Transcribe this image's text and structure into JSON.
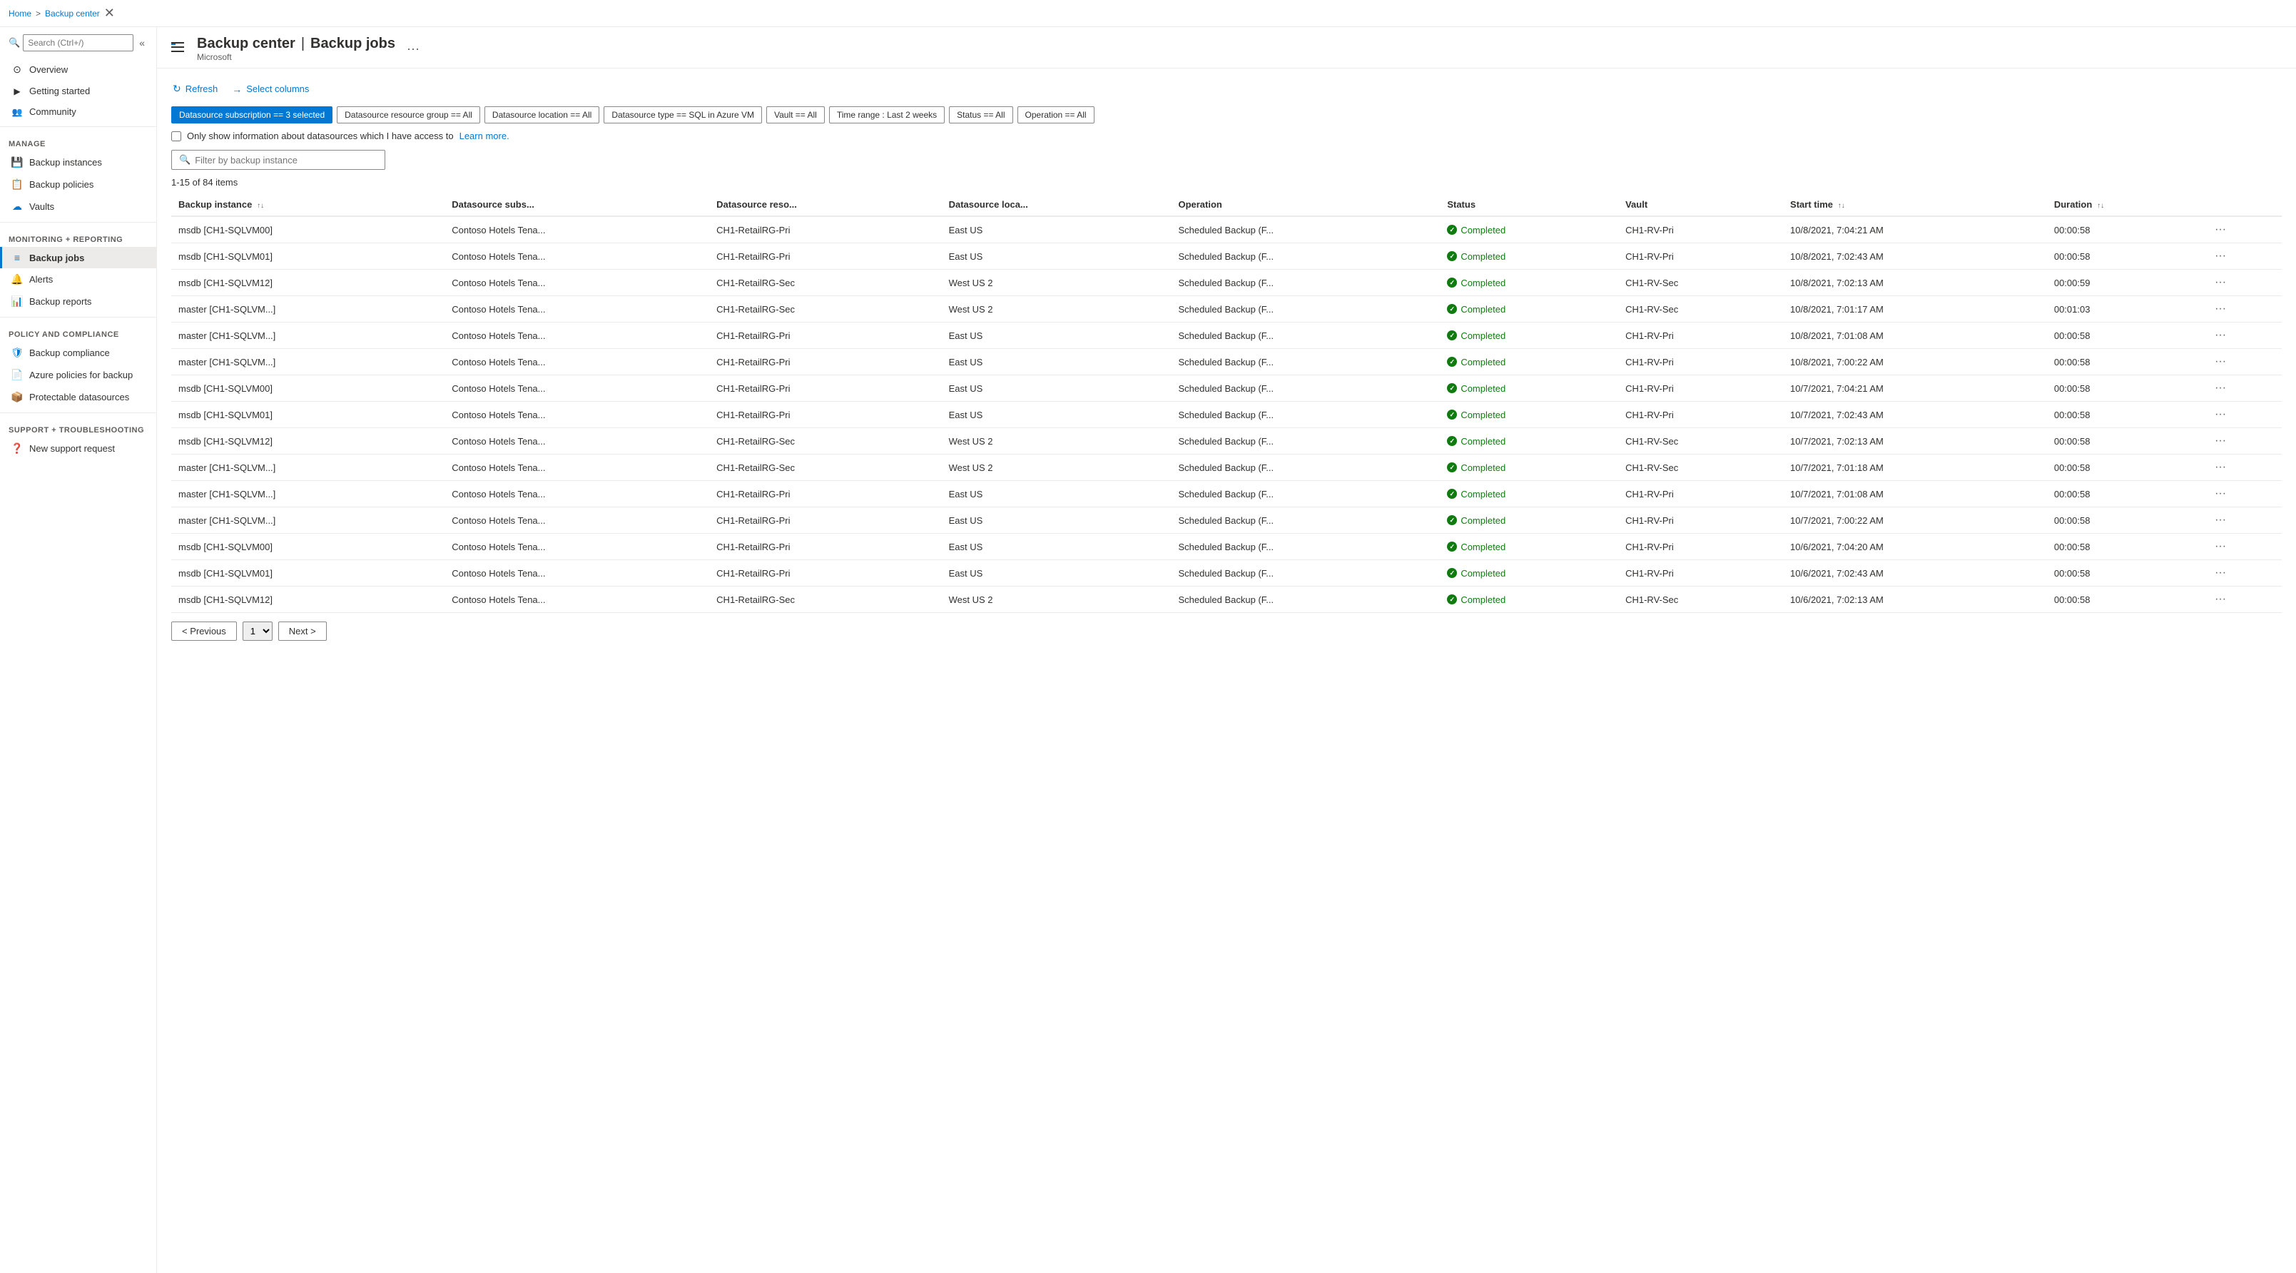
{
  "breadcrumb": {
    "home": "Home",
    "section": "Backup center"
  },
  "header": {
    "title": "Backup center",
    "separator": "|",
    "page": "Backup jobs",
    "subtitle": "Microsoft",
    "more_label": "···"
  },
  "toolbar": {
    "refresh_label": "Refresh",
    "select_columns_label": "Select columns"
  },
  "filters": [
    {
      "id": "datasource_subscription",
      "label": "Datasource subscription == 3 selected",
      "active": true
    },
    {
      "id": "datasource_resource_group",
      "label": "Datasource resource group == All",
      "active": false
    },
    {
      "id": "datasource_location",
      "label": "Datasource location == All",
      "active": false
    },
    {
      "id": "datasource_type",
      "label": "Datasource type == SQL in Azure VM",
      "active": false
    },
    {
      "id": "vault",
      "label": "Vault == All",
      "active": false
    },
    {
      "id": "time_range",
      "label": "Time range : Last 2 weeks",
      "active": false
    },
    {
      "id": "status",
      "label": "Status == All",
      "active": false
    },
    {
      "id": "operation",
      "label": "Operation == All",
      "active": false
    }
  ],
  "checkbox": {
    "label": "Only show information about datasources which I have access to",
    "learn_more": "Learn more."
  },
  "filter_search": {
    "placeholder": "Filter by backup instance"
  },
  "items_count": "1-15 of 84 items",
  "table": {
    "columns": [
      {
        "id": "backup_instance",
        "label": "Backup instance",
        "sortable": true
      },
      {
        "id": "datasource_subs",
        "label": "Datasource subs...",
        "sortable": false
      },
      {
        "id": "datasource_reso",
        "label": "Datasource reso...",
        "sortable": false
      },
      {
        "id": "datasource_loca",
        "label": "Datasource loca...",
        "sortable": false
      },
      {
        "id": "operation",
        "label": "Operation",
        "sortable": false
      },
      {
        "id": "status",
        "label": "Status",
        "sortable": false
      },
      {
        "id": "vault",
        "label": "Vault",
        "sortable": false
      },
      {
        "id": "start_time",
        "label": "Start time",
        "sortable": true
      },
      {
        "id": "duration",
        "label": "Duration",
        "sortable": true
      }
    ],
    "rows": [
      {
        "backup_instance": "msdb [CH1-SQLVM00]",
        "datasource_subs": "Contoso Hotels Tena...",
        "datasource_reso": "CH1-RetailRG-Pri",
        "datasource_loca": "East US",
        "operation": "Scheduled Backup (F...",
        "status": "Completed",
        "vault": "CH1-RV-Pri",
        "start_time": "10/8/2021, 7:04:21 AM",
        "duration": "00:00:58"
      },
      {
        "backup_instance": "msdb [CH1-SQLVM01]",
        "datasource_subs": "Contoso Hotels Tena...",
        "datasource_reso": "CH1-RetailRG-Pri",
        "datasource_loca": "East US",
        "operation": "Scheduled Backup (F...",
        "status": "Completed",
        "vault": "CH1-RV-Pri",
        "start_time": "10/8/2021, 7:02:43 AM",
        "duration": "00:00:58"
      },
      {
        "backup_instance": "msdb [CH1-SQLVM12]",
        "datasource_subs": "Contoso Hotels Tena...",
        "datasource_reso": "CH1-RetailRG-Sec",
        "datasource_loca": "West US 2",
        "operation": "Scheduled Backup (F...",
        "status": "Completed",
        "vault": "CH1-RV-Sec",
        "start_time": "10/8/2021, 7:02:13 AM",
        "duration": "00:00:59"
      },
      {
        "backup_instance": "master [CH1-SQLVM...]",
        "datasource_subs": "Contoso Hotels Tena...",
        "datasource_reso": "CH1-RetailRG-Sec",
        "datasource_loca": "West US 2",
        "operation": "Scheduled Backup (F...",
        "status": "Completed",
        "vault": "CH1-RV-Sec",
        "start_time": "10/8/2021, 7:01:17 AM",
        "duration": "00:01:03"
      },
      {
        "backup_instance": "master [CH1-SQLVM...]",
        "datasource_subs": "Contoso Hotels Tena...",
        "datasource_reso": "CH1-RetailRG-Pri",
        "datasource_loca": "East US",
        "operation": "Scheduled Backup (F...",
        "status": "Completed",
        "vault": "CH1-RV-Pri",
        "start_time": "10/8/2021, 7:01:08 AM",
        "duration": "00:00:58"
      },
      {
        "backup_instance": "master [CH1-SQLVM...]",
        "datasource_subs": "Contoso Hotels Tena...",
        "datasource_reso": "CH1-RetailRG-Pri",
        "datasource_loca": "East US",
        "operation": "Scheduled Backup (F...",
        "status": "Completed",
        "vault": "CH1-RV-Pri",
        "start_time": "10/8/2021, 7:00:22 AM",
        "duration": "00:00:58"
      },
      {
        "backup_instance": "msdb [CH1-SQLVM00]",
        "datasource_subs": "Contoso Hotels Tena...",
        "datasource_reso": "CH1-RetailRG-Pri",
        "datasource_loca": "East US",
        "operation": "Scheduled Backup (F...",
        "status": "Completed",
        "vault": "CH1-RV-Pri",
        "start_time": "10/7/2021, 7:04:21 AM",
        "duration": "00:00:58"
      },
      {
        "backup_instance": "msdb [CH1-SQLVM01]",
        "datasource_subs": "Contoso Hotels Tena...",
        "datasource_reso": "CH1-RetailRG-Pri",
        "datasource_loca": "East US",
        "operation": "Scheduled Backup (F...",
        "status": "Completed",
        "vault": "CH1-RV-Pri",
        "start_time": "10/7/2021, 7:02:43 AM",
        "duration": "00:00:58"
      },
      {
        "backup_instance": "msdb [CH1-SQLVM12]",
        "datasource_subs": "Contoso Hotels Tena...",
        "datasource_reso": "CH1-RetailRG-Sec",
        "datasource_loca": "West US 2",
        "operation": "Scheduled Backup (F...",
        "status": "Completed",
        "vault": "CH1-RV-Sec",
        "start_time": "10/7/2021, 7:02:13 AM",
        "duration": "00:00:58"
      },
      {
        "backup_instance": "master [CH1-SQLVM...]",
        "datasource_subs": "Contoso Hotels Tena...",
        "datasource_reso": "CH1-RetailRG-Sec",
        "datasource_loca": "West US 2",
        "operation": "Scheduled Backup (F...",
        "status": "Completed",
        "vault": "CH1-RV-Sec",
        "start_time": "10/7/2021, 7:01:18 AM",
        "duration": "00:00:58"
      },
      {
        "backup_instance": "master [CH1-SQLVM...]",
        "datasource_subs": "Contoso Hotels Tena...",
        "datasource_reso": "CH1-RetailRG-Pri",
        "datasource_loca": "East US",
        "operation": "Scheduled Backup (F...",
        "status": "Completed",
        "vault": "CH1-RV-Pri",
        "start_time": "10/7/2021, 7:01:08 AM",
        "duration": "00:00:58"
      },
      {
        "backup_instance": "master [CH1-SQLVM...]",
        "datasource_subs": "Contoso Hotels Tena...",
        "datasource_reso": "CH1-RetailRG-Pri",
        "datasource_loca": "East US",
        "operation": "Scheduled Backup (F...",
        "status": "Completed",
        "vault": "CH1-RV-Pri",
        "start_time": "10/7/2021, 7:00:22 AM",
        "duration": "00:00:58"
      },
      {
        "backup_instance": "msdb [CH1-SQLVM00]",
        "datasource_subs": "Contoso Hotels Tena...",
        "datasource_reso": "CH1-RetailRG-Pri",
        "datasource_loca": "East US",
        "operation": "Scheduled Backup (F...",
        "status": "Completed",
        "vault": "CH1-RV-Pri",
        "start_time": "10/6/2021, 7:04:20 AM",
        "duration": "00:00:58"
      },
      {
        "backup_instance": "msdb [CH1-SQLVM01]",
        "datasource_subs": "Contoso Hotels Tena...",
        "datasource_reso": "CH1-RetailRG-Pri",
        "datasource_loca": "East US",
        "operation": "Scheduled Backup (F...",
        "status": "Completed",
        "vault": "CH1-RV-Pri",
        "start_time": "10/6/2021, 7:02:43 AM",
        "duration": "00:00:58"
      },
      {
        "backup_instance": "msdb [CH1-SQLVM12]",
        "datasource_subs": "Contoso Hotels Tena...",
        "datasource_reso": "CH1-RetailRG-Sec",
        "datasource_loca": "West US 2",
        "operation": "Scheduled Backup (F...",
        "status": "Completed",
        "vault": "CH1-RV-Sec",
        "start_time": "10/6/2021, 7:02:13 AM",
        "duration": "00:00:58"
      }
    ]
  },
  "pagination": {
    "prev_label": "< Previous",
    "next_label": "Next >",
    "page_number": "1"
  },
  "sidebar": {
    "search_placeholder": "Search (Ctrl+/)",
    "sections": [
      {
        "label": "",
        "items": [
          {
            "id": "overview",
            "label": "Overview",
            "icon": "⊙"
          },
          {
            "id": "getting-started",
            "label": "Getting started",
            "icon": "🚀"
          },
          {
            "id": "community",
            "label": "Community",
            "icon": "👥"
          }
        ]
      },
      {
        "label": "Manage",
        "items": [
          {
            "id": "backup-instances",
            "label": "Backup instances",
            "icon": "💾"
          },
          {
            "id": "backup-policies",
            "label": "Backup policies",
            "icon": "📋"
          },
          {
            "id": "vaults",
            "label": "Vaults",
            "icon": "☁"
          }
        ]
      },
      {
        "label": "Monitoring + reporting",
        "items": [
          {
            "id": "backup-jobs",
            "label": "Backup jobs",
            "icon": "≡",
            "active": true
          },
          {
            "id": "alerts",
            "label": "Alerts",
            "icon": "🔔"
          },
          {
            "id": "backup-reports",
            "label": "Backup reports",
            "icon": "📊"
          }
        ]
      },
      {
        "label": "Policy and compliance",
        "items": [
          {
            "id": "backup-compliance",
            "label": "Backup compliance",
            "icon": "🛡"
          },
          {
            "id": "azure-policies",
            "label": "Azure policies for backup",
            "icon": "📄"
          },
          {
            "id": "protectable-datasources",
            "label": "Protectable datasources",
            "icon": "📦"
          }
        ]
      },
      {
        "label": "Support + troubleshooting",
        "items": [
          {
            "id": "new-support-request",
            "label": "New support request",
            "icon": "❓"
          }
        ]
      }
    ]
  }
}
